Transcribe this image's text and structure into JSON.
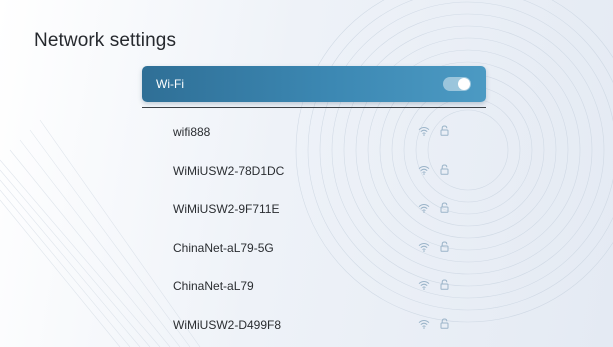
{
  "page": {
    "title": "Network settings"
  },
  "wifi": {
    "label": "Wi-Fi",
    "enabled": true
  },
  "networks": [
    {
      "name": "wifi888",
      "secured": true,
      "signal_icon": "wifi-signal-icon",
      "lock_icon": "lock-icon"
    },
    {
      "name": "WiMiUSW2-78D1DC",
      "secured": true,
      "signal_icon": "wifi-signal-icon",
      "lock_icon": "lock-icon"
    },
    {
      "name": "WiMiUSW2-9F711E",
      "secured": true,
      "signal_icon": "wifi-signal-icon",
      "lock_icon": "lock-icon"
    },
    {
      "name": "ChinaNet-aL79-5G",
      "secured": true,
      "signal_icon": "wifi-signal-icon",
      "lock_icon": "lock-icon"
    },
    {
      "name": "ChinaNet-aL79",
      "secured": true,
      "signal_icon": "wifi-signal-icon",
      "lock_icon": "lock-icon"
    },
    {
      "name": "WiMiUSW2-D499F8",
      "secured": true,
      "signal_icon": "wifi-signal-icon",
      "lock_icon": "lock-icon"
    }
  ],
  "colors": {
    "accent": "#3c88b3",
    "icon": "#9bb4c9"
  }
}
